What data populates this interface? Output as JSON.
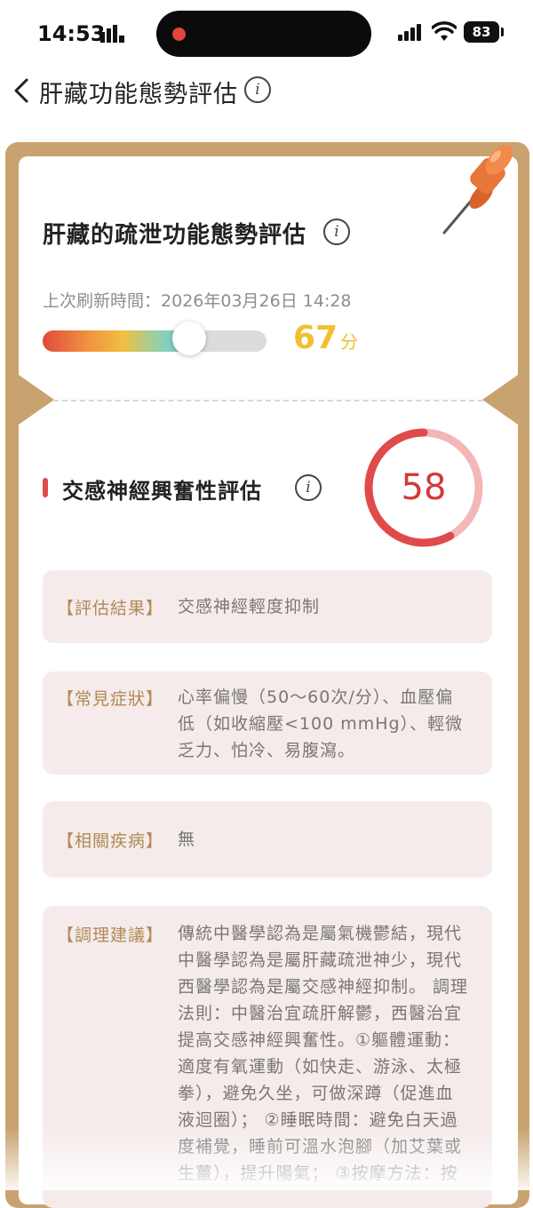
{
  "status_bar": {
    "time": "14:53",
    "battery": "83"
  },
  "nav": {
    "title": "肝藏功能態勢評估",
    "info_icon": "info-icon"
  },
  "card": {
    "title": "肝藏的疏泄功能態勢評估",
    "refresh_label": "上次刷新時間：",
    "refresh_time": "2026年03月26日 14:28",
    "score": "67",
    "score_unit": "分",
    "score_fraction": 0.67
  },
  "section": {
    "title": "交感神經興奮性評估",
    "score": "58",
    "score_fraction": 0.58,
    "ring_color": "#e04a4a",
    "ring_track_color": "#f3b7b7",
    "items": [
      {
        "label": "【評估結果】",
        "text": "交感神經輕度抑制"
      },
      {
        "label": "【常見症狀】",
        "text": "心率偏慢（50～60次/分）、血壓偏低（如收縮壓<100 mmHg）、輕微乏力、怕冷、易腹瀉。"
      },
      {
        "label": "【相關疾病】",
        "text": "無"
      },
      {
        "label": "【調理建議】",
        "text": "傳統中醫學認為是屬氣機鬱結，現代中醫學認為是屬肝藏疏泄神少，現代西醫學認為是屬交感神經抑制。 調理法則：中醫治宜疏肝解鬱，西醫治宜提高交感神經興奮性。①軀體運動：適度有氧運動（如快走、游泳、太極拳），避免久坐，可做深蹲（促進血液迴圈）； ②睡眠時間：避免白天過度補覺，睡前可溫水泡腳（加艾葉或生薑），提升陽氣； ③按摩方法：按"
      }
    ]
  }
}
